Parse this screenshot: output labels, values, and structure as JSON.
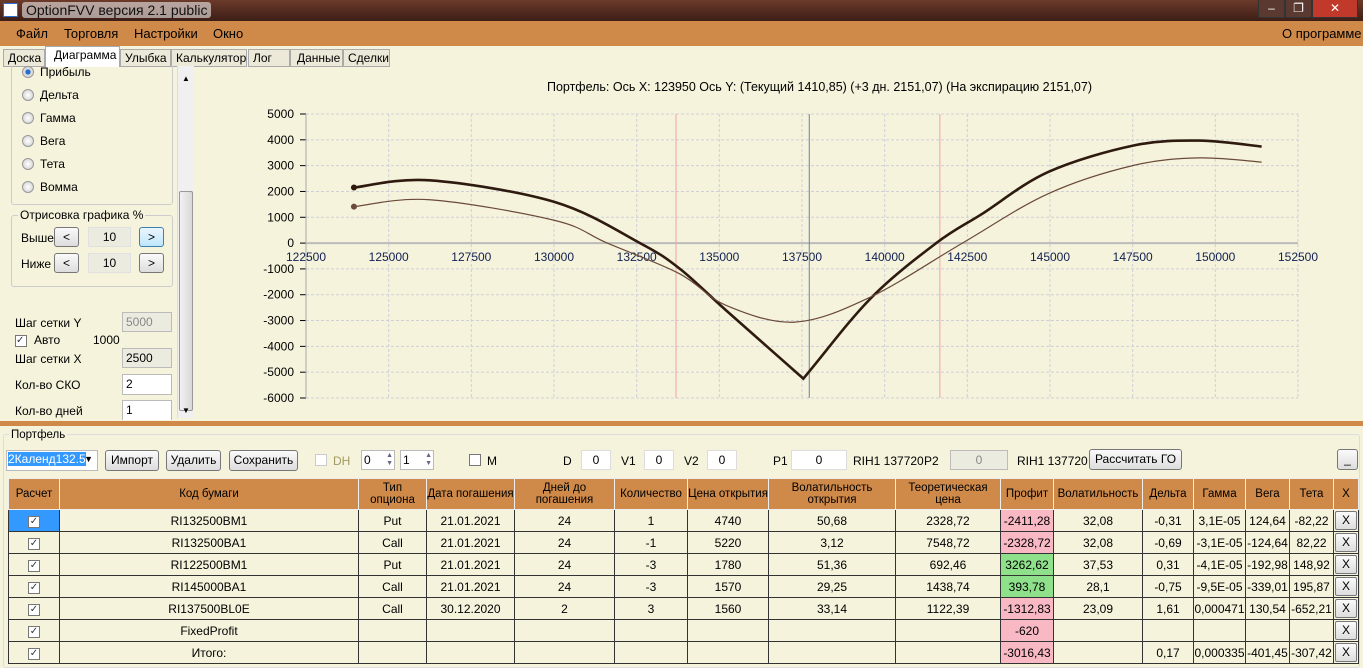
{
  "window": {
    "title": "OptionFVV версия 2.1 public"
  },
  "menu": {
    "items": [
      "Файл",
      "Торговля",
      "Настройки",
      "Окно"
    ],
    "about": "О программе"
  },
  "tabs": [
    "Доска",
    "Диаграмма",
    "Улыбка",
    "Калькулятор",
    "Лог",
    "Данные",
    "Сделки"
  ],
  "left": {
    "radios": [
      {
        "label": "Прибыль",
        "checked": true
      },
      {
        "label": "Дельта"
      },
      {
        "label": "Гамма"
      },
      {
        "label": "Вега"
      },
      {
        "label": "Тета"
      },
      {
        "label": "Вомма"
      }
    ],
    "draw_group": "Отрисовка графика %",
    "above": "Выше",
    "below": "Ниже",
    "above_val": "10",
    "below_val": "10",
    "prev": "<",
    "next": ">",
    "grid_y_label": "Шаг сетки Y",
    "grid_y_val": "5000",
    "auto_label": "Авто",
    "auto_val": "1000",
    "grid_x_label": "Шаг сетки X",
    "grid_x_val": "2500",
    "sko_label": "Кол-во СКО",
    "sko_val": "2",
    "days_label": "Кол-во дней",
    "days_val": "1"
  },
  "chart_data": {
    "type": "line",
    "title": "Портфель: Ось X: 123950 Ось Y:  (Текущий 1410,85)  (+3 дн. 2151,07)  (На экспирацию 2151,07)",
    "xlim": [
      122500,
      152500
    ],
    "ylim": [
      -6000,
      5000
    ],
    "xticks": [
      122500,
      125000,
      127500,
      130000,
      132500,
      135000,
      137500,
      140000,
      142500,
      145000,
      147500,
      150000,
      152500
    ],
    "yticks": [
      5000,
      4000,
      3000,
      2000,
      1000,
      0,
      -1000,
      -2000,
      -3000,
      -4000,
      -5000,
      -6000
    ],
    "grid": true,
    "vlines": [
      {
        "x": 133690,
        "color": "#f4a0a8"
      },
      {
        "x": 137720,
        "color": "#6a7fb0"
      },
      {
        "x": 141670,
        "color": "#f4a0a8"
      }
    ],
    "series": [
      {
        "color": "#2e1a0e",
        "width": 2.6,
        "x": [
          123950,
          126240,
          130020,
          132600,
          133800,
          135200,
          137540,
          139570,
          141560,
          142950,
          144940,
          147530,
          149520,
          151400
        ],
        "y": [
          2151,
          2430,
          1590,
          0,
          -990,
          -2600,
          -5250,
          -2150,
          0,
          1135,
          2750,
          3780,
          3970,
          3740
        ]
      },
      {
        "color": "#6b4a3a",
        "width": 1.2,
        "x": [
          123950,
          126240,
          130020,
          131610,
          133800,
          135200,
          137290,
          139570,
          142350,
          144940,
          147530,
          149520,
          151400
        ],
        "y": [
          1411,
          1680,
          880,
          0,
          -1190,
          -2410,
          -3060,
          -2090,
          0,
          1910,
          3010,
          3300,
          3135
        ]
      }
    ]
  },
  "portfolio": {
    "group": "Портфель",
    "selected": "2Календ132.5",
    "import": "Импорт",
    "delete": "Удалить",
    "save": "Сохранить",
    "dh": "DH",
    "spin1": "0",
    "spin2": "1",
    "m": "M",
    "d_label": "D",
    "d_val": "0",
    "v1_label": "V1",
    "v1_val": "0",
    "v2_label": "V2",
    "v2_val": "0",
    "p1_label": "P1",
    "p1_val": "0",
    "p1_sec": "RIH1 137720",
    "p2_label": "P2",
    "p2_val": "0",
    "p2_sec": "RIH1 137720",
    "calc_go": "Рассчитать ГО",
    "minimize": "_"
  },
  "table": {
    "headers": [
      "Расчет",
      "Код бумаги",
      "Тип опциона",
      "Дата погашения",
      "Дней до погашения",
      "Количество",
      "Цена открытия",
      "Волатильность открытия",
      "Теоретическая цена",
      "Профит",
      "Волатильность",
      "Дельта",
      "Гамма",
      "Вега",
      "Тета",
      "X"
    ],
    "rows": [
      [
        "RI132500BM1",
        "Put",
        "21.01.2021",
        "24",
        "1",
        "4740",
        "50,68",
        "2328,72",
        "-2411,28",
        "32,08",
        "-0,31",
        "3,1E-05",
        "124,64",
        "-82,22"
      ],
      [
        "RI132500BA1",
        "Call",
        "21.01.2021",
        "24",
        "-1",
        "5220",
        "3,12",
        "7548,72",
        "-2328,72",
        "32,08",
        "-0,69",
        "-3,1E-05",
        "-124,64",
        "82,22"
      ],
      [
        "RI122500BM1",
        "Put",
        "21.01.2021",
        "24",
        "-3",
        "1780",
        "51,36",
        "692,46",
        "3262,62",
        "37,53",
        "0,31",
        "-4,1E-05",
        "-192,98",
        "148,92"
      ],
      [
        "RI145000BA1",
        "Call",
        "21.01.2021",
        "24",
        "-3",
        "1570",
        "29,25",
        "1438,74",
        "393,78",
        "28,1",
        "-0,75",
        "-9,5E-05",
        "-339,01",
        "195,87"
      ],
      [
        "RI137500BL0E",
        "Call",
        "30.12.2020",
        "2",
        "3",
        "1560",
        "33,14",
        "1122,39",
        "-1312,83",
        "23,09",
        "1,61",
        "0,000471",
        "130,54",
        "-652,21"
      ],
      [
        "FixedProfit",
        "",
        "",
        "",
        "",
        "",
        "",
        "",
        "-620",
        "",
        "",
        "",
        "",
        ""
      ],
      [
        "Итого:",
        "",
        "",
        "",
        "",
        "",
        "",
        "",
        "-3016,43",
        "",
        "0,17",
        "0,000335",
        "-401,45",
        "-307,42"
      ]
    ],
    "profit_colors": [
      "pink",
      "pink",
      "green",
      "green",
      "pink",
      "pink",
      "pink"
    ],
    "checked": "✓",
    "x_label": "X"
  }
}
